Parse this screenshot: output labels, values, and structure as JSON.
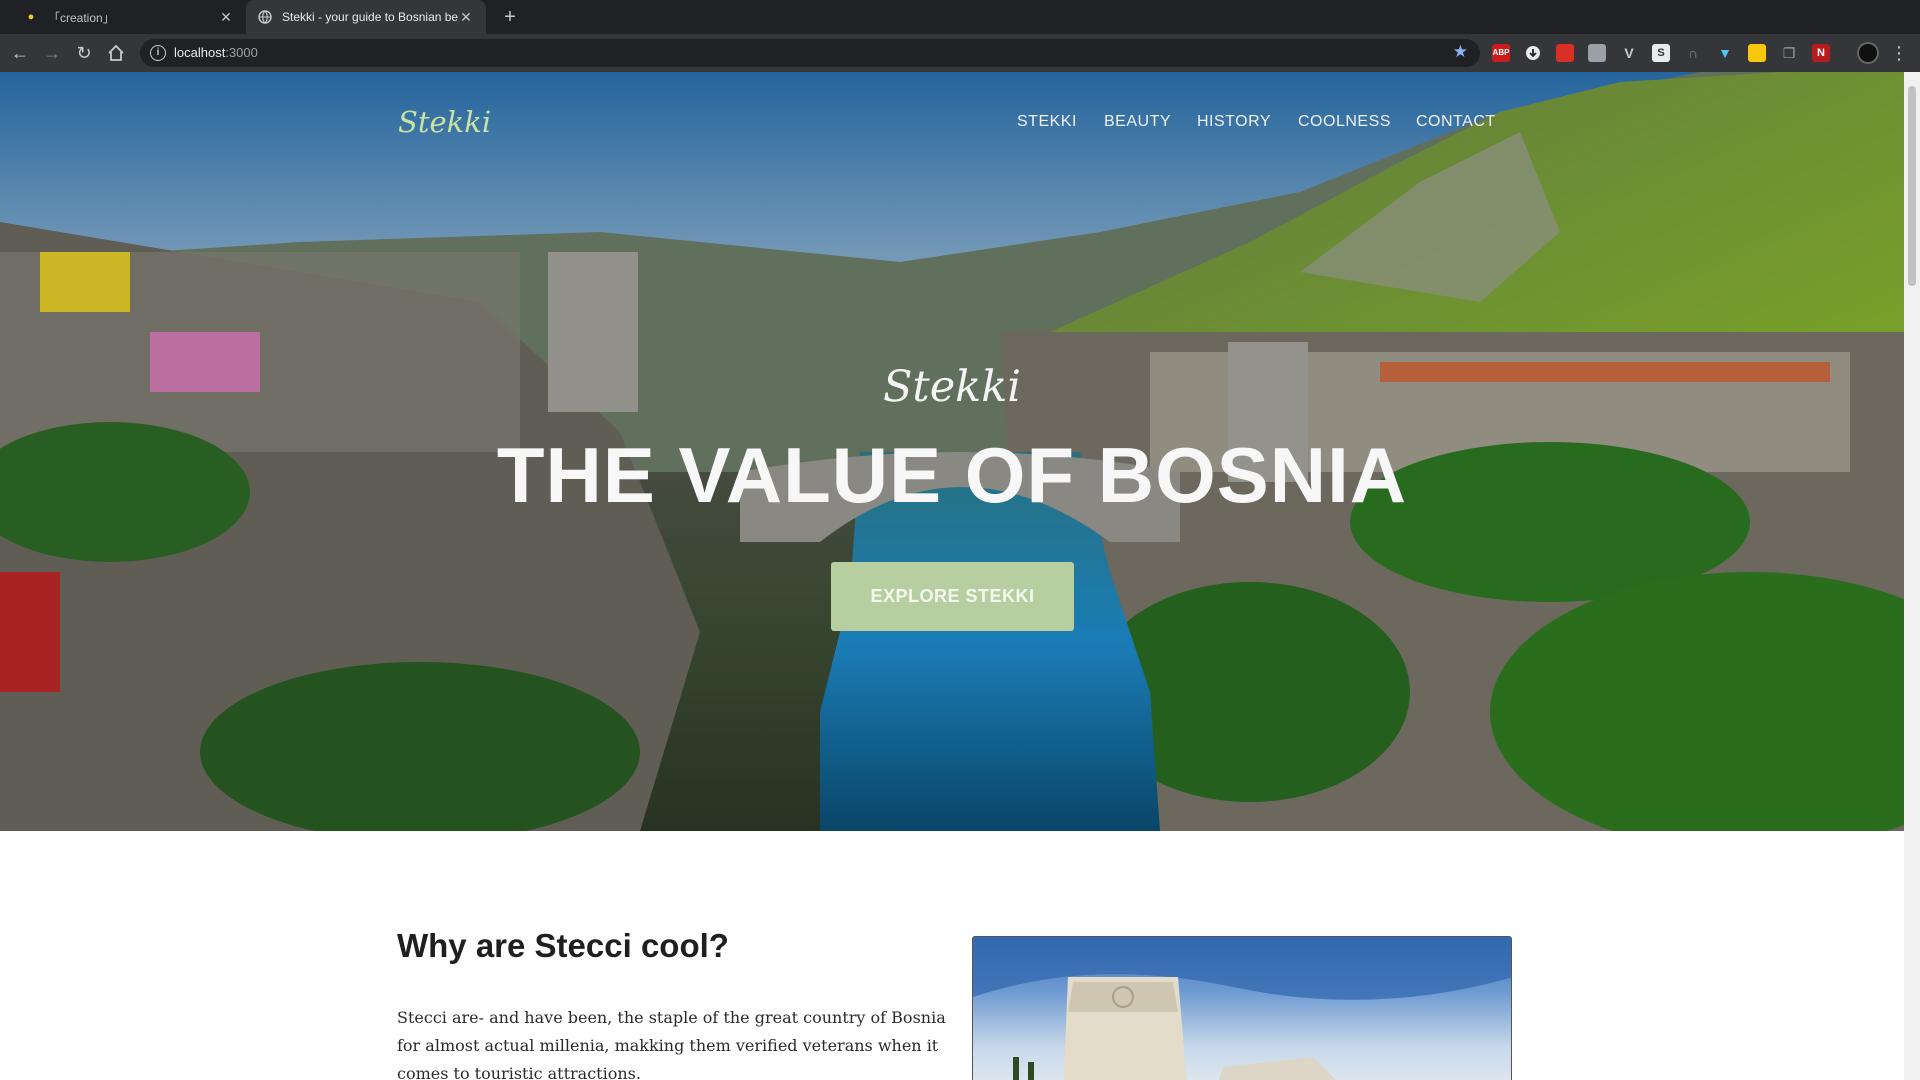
{
  "browser": {
    "tabs": [
      {
        "title": "「creation」",
        "active": false
      },
      {
        "title": "Stekki - your guide to Bosnian be",
        "active": true
      }
    ],
    "url_host": "localhost",
    "url_port": ":3000",
    "extension_icons": [
      "abp-icon",
      "download-icon",
      "calendar-icon",
      "notes-icon",
      "vue-icon",
      "s-icon",
      "headset-icon",
      "filter-icon",
      "folder-icon",
      "tabs-icon",
      "n-icon"
    ]
  },
  "site": {
    "logo": "Stekki",
    "nav": [
      "STEKKI",
      "BEAUTY",
      "HISTORY",
      "COOLNESS",
      "CONTACT"
    ],
    "hero": {
      "subtitle": "Stekki",
      "title": "THE VALUE OF BOSNIA",
      "cta": "EXPLORE STEKKI"
    },
    "section": {
      "heading": "Why are Stecci cool?",
      "text": "Stecci are- and have been, the staple of the great country of Bosnia for almost actual millenia, makking them verified veterans when it comes to touristic attractions."
    }
  },
  "colors": {
    "logo": "#c8e3a2",
    "cta_bg": "#b7cfa0",
    "chrome_dark": "#202124",
    "chrome_toolbar": "#35363a",
    "star": "#8ab4f8"
  }
}
